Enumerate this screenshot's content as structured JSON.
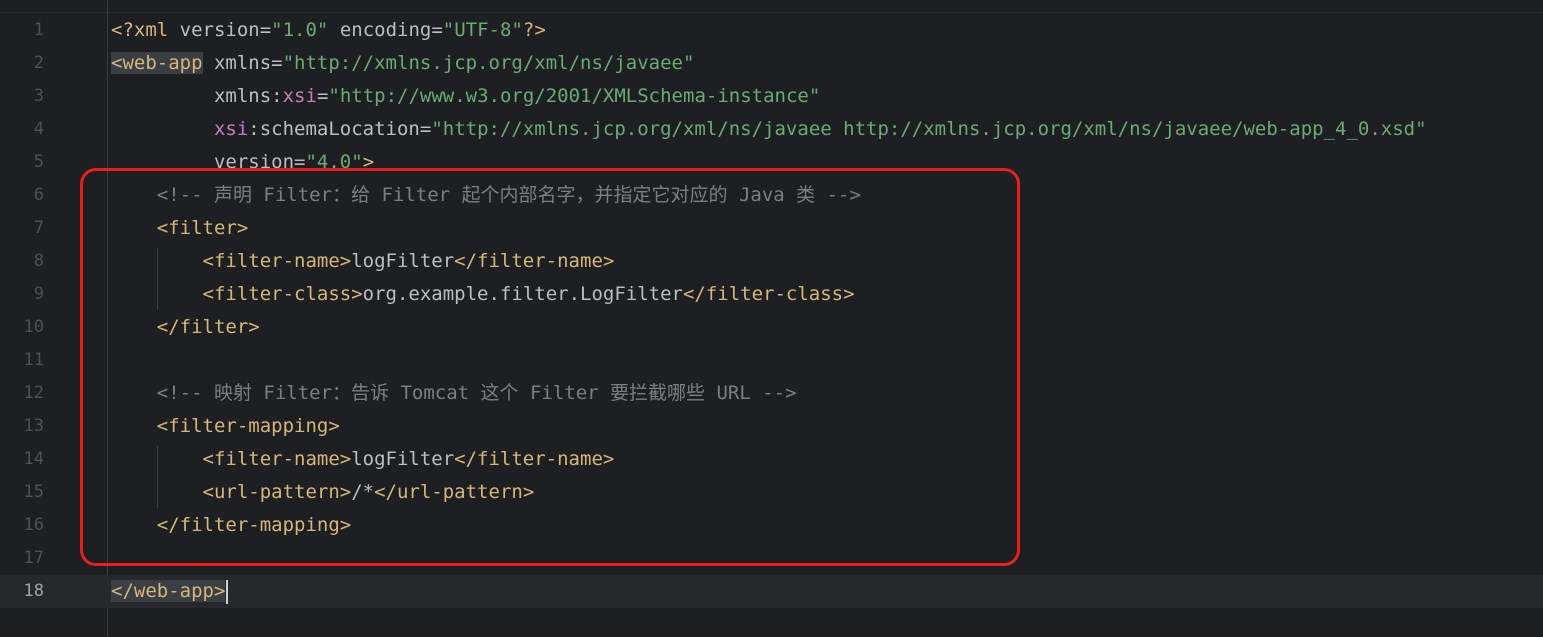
{
  "editor": {
    "lines": [
      {
        "n": "1",
        "tokens": [
          {
            "t": "<?xml ",
            "c": "tag"
          },
          {
            "t": "version",
            "c": "attr"
          },
          {
            "t": "=",
            "c": "attr"
          },
          {
            "t": "\"1.0\"",
            "c": "val"
          },
          {
            "t": " ",
            "c": "text"
          },
          {
            "t": "encoding",
            "c": "attr"
          },
          {
            "t": "=",
            "c": "attr"
          },
          {
            "t": "\"UTF-8\"",
            "c": "val"
          },
          {
            "t": "?>",
            "c": "tag"
          }
        ]
      },
      {
        "n": "2",
        "tokens": [
          {
            "t": "<web-app",
            "c": "tag tag-hl"
          },
          {
            "t": " xmlns",
            "c": "attr"
          },
          {
            "t": "=",
            "c": "attr"
          },
          {
            "t": "\"http://xmlns.jcp.org/xml/ns/javaee\"",
            "c": "val"
          }
        ]
      },
      {
        "n": "3",
        "tokens": [
          {
            "t": "         xmlns",
            "c": "attr"
          },
          {
            "t": ":",
            "c": "attr"
          },
          {
            "t": "xsi",
            "c": "ns"
          },
          {
            "t": "=",
            "c": "attr"
          },
          {
            "t": "\"http://www.w3.org/2001/XMLSchema-instance\"",
            "c": "val"
          }
        ]
      },
      {
        "n": "4",
        "tokens": [
          {
            "t": "         ",
            "c": "text"
          },
          {
            "t": "xsi",
            "c": "ns"
          },
          {
            "t": ":schemaLocation",
            "c": "attr"
          },
          {
            "t": "=",
            "c": "attr"
          },
          {
            "t": "\"http://xmlns.jcp.org/xml/ns/javaee http://xmlns.jcp.org/xml/ns/javaee/web-app_4_0.xsd\"",
            "c": "val"
          }
        ]
      },
      {
        "n": "5",
        "tokens": [
          {
            "t": "         version",
            "c": "attr"
          },
          {
            "t": "=",
            "c": "attr"
          },
          {
            "t": "\"4.0\"",
            "c": "val"
          },
          {
            "t": ">",
            "c": "tag"
          }
        ]
      },
      {
        "n": "6",
        "tokens": [
          {
            "t": "    <!-- 声明 Filter：给 Filter 起个内部名字，并指定它对应的 Java 类 -->",
            "c": "comment"
          }
        ]
      },
      {
        "n": "7",
        "tokens": [
          {
            "t": "    <filter>",
            "c": "tag"
          }
        ]
      },
      {
        "n": "8",
        "tokens": [
          {
            "t": "        <filter-name>",
            "c": "tag"
          },
          {
            "t": "logFilter",
            "c": "text"
          },
          {
            "t": "</filter-name>",
            "c": "tag"
          }
        ]
      },
      {
        "n": "9",
        "tokens": [
          {
            "t": "        <filter-class>",
            "c": "tag"
          },
          {
            "t": "org.example.filter.LogFilter",
            "c": "text"
          },
          {
            "t": "</filter-class>",
            "c": "tag"
          }
        ]
      },
      {
        "n": "10",
        "tokens": [
          {
            "t": "    </filter>",
            "c": "tag"
          }
        ]
      },
      {
        "n": "11",
        "tokens": []
      },
      {
        "n": "12",
        "tokens": [
          {
            "t": "    <!-- 映射 Filter：告诉 Tomcat 这个 Filter 要拦截哪些 URL -->",
            "c": "comment"
          }
        ]
      },
      {
        "n": "13",
        "tokens": [
          {
            "t": "    <filter-mapping>",
            "c": "tag"
          }
        ]
      },
      {
        "n": "14",
        "tokens": [
          {
            "t": "        <filter-name>",
            "c": "tag"
          },
          {
            "t": "logFilter",
            "c": "text"
          },
          {
            "t": "</filter-name>",
            "c": "tag"
          }
        ]
      },
      {
        "n": "15",
        "tokens": [
          {
            "t": "        <url-pattern>",
            "c": "tag"
          },
          {
            "t": "/*",
            "c": "text"
          },
          {
            "t": "</url-pattern>",
            "c": "tag"
          }
        ]
      },
      {
        "n": "16",
        "tokens": [
          {
            "t": "    </filter-mapping>",
            "c": "tag"
          }
        ]
      },
      {
        "n": "17",
        "tokens": []
      },
      {
        "n": "18",
        "tokens": [
          {
            "t": "</web-app>",
            "c": "tag tag-hl"
          }
        ],
        "current": true
      }
    ]
  },
  "colors": {
    "background": "#1e1f22",
    "tag": "#d5b778",
    "string": "#6aab73",
    "namespace": "#c77dbb",
    "comment": "#7a7e85",
    "highlight_box": "#e8201d"
  }
}
